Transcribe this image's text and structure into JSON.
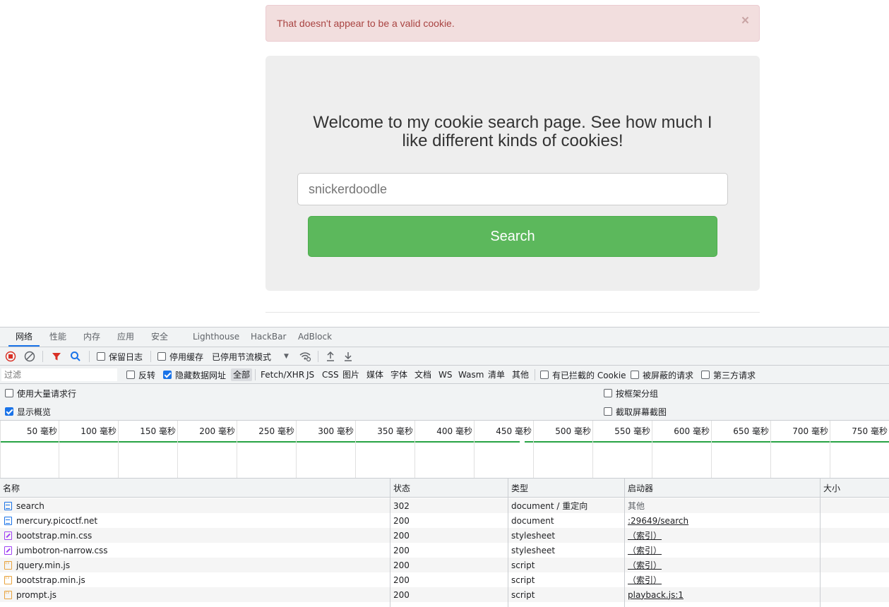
{
  "alert": {
    "message": "That doesn't appear to be a valid cookie.",
    "close": "×"
  },
  "jumbotron": {
    "heading": "Welcome to my cookie search page. See how much I like different kinds of cookies!",
    "input_placeholder": "snickerdoodle",
    "input_value": "",
    "button_label": "Search"
  },
  "devtools": {
    "tabs": [
      "网络",
      "性能",
      "内存",
      "应用",
      "安全",
      "Lighthouse",
      "HackBar",
      "AdBlock"
    ],
    "active_tab": "网络",
    "toolbar": {
      "preserve_log": {
        "label": "保留日志",
        "checked": false
      },
      "disable_cache": {
        "label": "停用缓存",
        "checked": false
      },
      "throttling": "已停用节流模式"
    },
    "filterbar": {
      "filter_placeholder": "过滤",
      "invert": {
        "label": "反转",
        "checked": false
      },
      "hide_data_urls": {
        "label": "隐藏数据网址",
        "checked": true
      },
      "types": [
        "全部",
        "Fetch/XHR",
        "JS",
        "CSS",
        "图片",
        "媒体",
        "字体",
        "文档",
        "WS",
        "Wasm",
        "清单",
        "其他"
      ],
      "selected_type": "全部",
      "blocked_cookies": {
        "label": "有已拦截的 Cookie",
        "checked": false
      },
      "blocked_requests": {
        "label": "被屏蔽的请求",
        "checked": false
      },
      "third_party": {
        "label": "第三方请求",
        "checked": false
      }
    },
    "options": {
      "big_rows": {
        "label": "使用大量请求行",
        "checked": false
      },
      "overview": {
        "label": "显示概览",
        "checked": true
      },
      "group_by_frame": {
        "label": "按框架分组",
        "checked": false
      },
      "screenshots": {
        "label": "截取屏幕截图",
        "checked": false
      }
    },
    "timeline_ticks": [
      "50 毫秒",
      "100 毫秒",
      "150 毫秒",
      "200 毫秒",
      "250 毫秒",
      "300 毫秒",
      "350 毫秒",
      "400 毫秒",
      "450 毫秒",
      "500 毫秒",
      "550 毫秒",
      "600 毫秒",
      "650 毫秒",
      "700 毫秒",
      "750 毫秒"
    ],
    "columns": {
      "name": "名称",
      "status": "状态",
      "type": "类型",
      "initiator": "启动器",
      "size": "大小"
    },
    "rows": [
      {
        "icon": "document-icon",
        "name": "search",
        "status": "302",
        "type": "document / 重定向",
        "initiator": "其他",
        "initiator_link": false
      },
      {
        "icon": "document-icon",
        "name": "mercury.picoctf.net",
        "status": "200",
        "type": "document",
        "initiator": ":29649/search",
        "initiator_link": true
      },
      {
        "icon": "stylesheet-icon",
        "name": "bootstrap.min.css",
        "status": "200",
        "type": "stylesheet",
        "initiator": "（索引）",
        "initiator_link": true
      },
      {
        "icon": "stylesheet-icon",
        "name": "jumbotron-narrow.css",
        "status": "200",
        "type": "stylesheet",
        "initiator": "（索引）",
        "initiator_link": true
      },
      {
        "icon": "script-icon",
        "name": "jquery.min.js",
        "status": "200",
        "type": "script",
        "initiator": "（索引）",
        "initiator_link": true
      },
      {
        "icon": "script-icon",
        "name": "bootstrap.min.js",
        "status": "200",
        "type": "script",
        "initiator": "（索引）",
        "initiator_link": true
      },
      {
        "icon": "script-icon",
        "name": "prompt.js",
        "status": "200",
        "type": "script",
        "initiator": "playback.js:1",
        "initiator_link": true
      }
    ]
  }
}
